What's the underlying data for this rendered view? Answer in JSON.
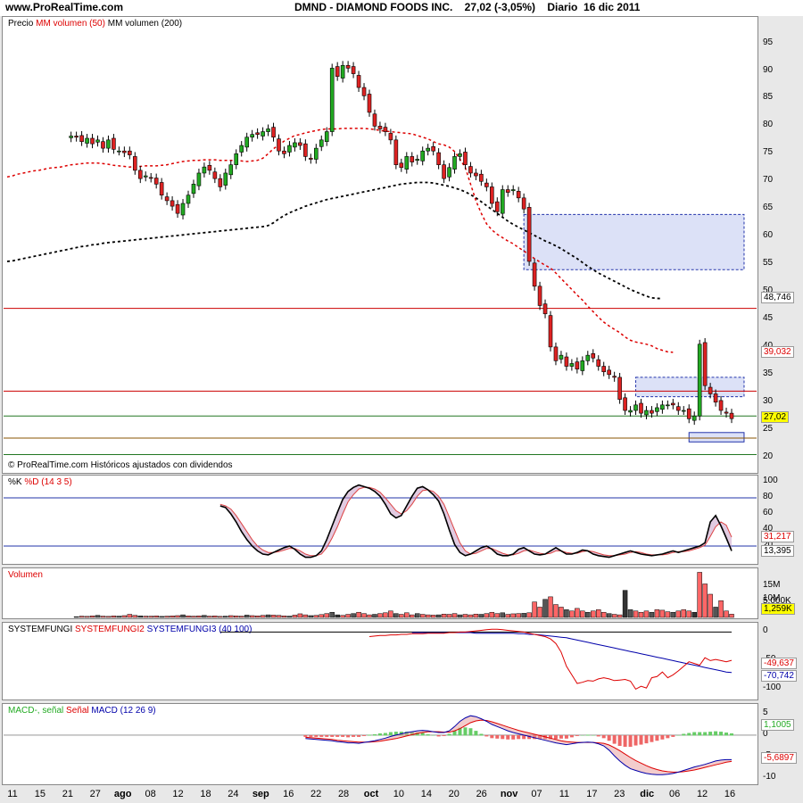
{
  "header": {
    "site": "www.ProRealTime.com",
    "title": "DMND - DIAMOND FOODS INC.    27,02 (-3,05%)    Diario  16 dic 2011"
  },
  "price_panel": {
    "legend_a": "Precio",
    "legend_b": "MM volumen (50)",
    "legend_c": "MM volumen (200)",
    "footer": "© ProRealTime.com  Históricos ajustados con dividendos",
    "ticks": [
      "95",
      "90",
      "85",
      "80",
      "75",
      "70",
      "65",
      "60",
      "55",
      "50",
      "45",
      "40",
      "35",
      "30",
      "25",
      "20"
    ],
    "value_boxes": {
      "ma200": "48,746",
      "ma50": "39,032",
      "last": "27,02"
    }
  },
  "stoch_panel": {
    "legend_a": "%K",
    "legend_b": "%D (14 3 5)",
    "ticks": [
      "100",
      "80",
      "60",
      "40",
      "20"
    ],
    "value_boxes": {
      "d": "31,217",
      "k": "13,395"
    }
  },
  "volume_panel": {
    "legend": "Volumen",
    "ticks": [
      "15M",
      "10M",
      "5,000K"
    ],
    "value_box": "1,259K"
  },
  "system_panel": {
    "legend_a": "SYSTEMFUNGI",
    "legend_b": "SYSTEMFUNGI2",
    "legend_c": "SYSTEMFUNGI3 (40 100)",
    "ticks": [
      "0",
      "-50",
      "-100"
    ],
    "value_boxes": {
      "red": "-49,637",
      "blue": "-70,742"
    }
  },
  "macd_panel": {
    "legend_a": "MACD-, señal",
    "legend_b": "Señal",
    "legend_c": "MACD (12 26 9)",
    "ticks": [
      "5",
      "0",
      "-5",
      "-10"
    ],
    "value_boxes": {
      "hist": "1,1005",
      "macd": "-5,6897"
    }
  },
  "x_axis": [
    {
      "label": "11",
      "bold": false
    },
    {
      "label": "15",
      "bold": false
    },
    {
      "label": "21",
      "bold": false
    },
    {
      "label": "27",
      "bold": false
    },
    {
      "label": "ago",
      "bold": true
    },
    {
      "label": "08",
      "bold": false
    },
    {
      "label": "12",
      "bold": false
    },
    {
      "label": "18",
      "bold": false
    },
    {
      "label": "24",
      "bold": false
    },
    {
      "label": "sep",
      "bold": true
    },
    {
      "label": "16",
      "bold": false
    },
    {
      "label": "22",
      "bold": false
    },
    {
      "label": "28",
      "bold": false
    },
    {
      "label": "oct",
      "bold": true
    },
    {
      "label": "10",
      "bold": false
    },
    {
      "label": "14",
      "bold": false
    },
    {
      "label": "20",
      "bold": false
    },
    {
      "label": "26",
      "bold": false
    },
    {
      "label": "nov",
      "bold": true
    },
    {
      "label": "07",
      "bold": false
    },
    {
      "label": "11",
      "bold": false
    },
    {
      "label": "17",
      "bold": false
    },
    {
      "label": "23",
      "bold": false
    },
    {
      "label": "dic",
      "bold": true
    },
    {
      "label": "06",
      "bold": false
    },
    {
      "label": "12",
      "bold": false
    },
    {
      "label": "16",
      "bold": false
    }
  ],
  "colors": {
    "up": "#22aa22",
    "down": "#dd2222",
    "ma50": "#dd0000",
    "ma200": "#000000",
    "grid": "#cc0000",
    "zone": "#bfc8f0"
  },
  "chart_data": {
    "type": "candlestick",
    "bars": 137,
    "price_ylim": [
      18,
      98
    ],
    "closes": [
      78.2,
      78.0,
      77.2,
      77.8,
      76.8,
      77.5,
      76.0,
      77.5,
      75.8,
      75.5,
      75.2,
      74.8,
      72.0,
      70.5,
      71.0,
      70.6,
      69.5,
      67.5,
      66.5,
      65.5,
      64.2,
      66.0,
      67.5,
      69.5,
      71.5,
      72.6,
      72.0,
      70.5,
      69.0,
      71.5,
      73.0,
      75.0,
      76.5,
      78.0,
      78.5,
      78.5,
      79.0,
      79.5,
      78.0,
      75.5,
      75.0,
      76.5,
      77.0,
      76.5,
      74.5,
      74.0,
      76.0,
      77.5,
      79.0,
      90.5,
      89.0,
      91.0,
      90.5,
      89.5,
      87.0,
      85.5,
      82.5,
      80.0,
      79.5,
      79.0,
      77.5,
      73.0,
      72.5,
      74.5,
      73.5,
      74.0,
      75.5,
      76.0,
      75.5,
      73.0,
      70.5,
      72.5,
      74.5,
      75.0,
      73.0,
      71.5,
      71.0,
      70.0,
      69.0,
      66.0,
      64.5,
      68.5,
      68.0,
      68.5,
      67.0,
      65.0,
      55.5,
      51.0,
      47.5,
      46.0,
      40.0,
      37.5,
      38.5,
      36.5,
      37.0,
      36.0,
      37.5,
      38.5,
      38.0,
      36.5,
      35.5,
      35.0,
      34.5,
      30.5,
      28.5,
      28.5,
      29.5,
      28.0,
      28.5,
      28.0,
      29.0,
      29.5,
      29.5,
      29.5,
      28.5,
      28.5,
      27.0,
      27.5,
      40.5,
      33.0,
      31.5,
      30.0,
      28.5,
      28.0,
      27.02
    ],
    "ma50": [
      70.8,
      71.0,
      71.3,
      71.5,
      71.7,
      71.9,
      72.0,
      72.2,
      72.4,
      72.5,
      72.6,
      72.8,
      73.0,
      73.1,
      73.2,
      73.3,
      73.3,
      73.3,
      73.2,
      73.1,
      72.9,
      72.8,
      72.7,
      72.6,
      72.7,
      72.7,
      72.8,
      72.8,
      72.8,
      72.9,
      73.0,
      73.2,
      73.4,
      73.6,
      73.7,
      73.8,
      73.8,
      73.9,
      73.9,
      73.9,
      73.8,
      73.8,
      73.8,
      73.8,
      73.7,
      73.6,
      73.7,
      73.8,
      74.2,
      75.0,
      75.9,
      76.6,
      77.3,
      77.8,
      78.3,
      78.5,
      78.8,
      79.0,
      79.2,
      79.4,
      79.5,
      79.5,
      79.5,
      79.6,
      79.6,
      79.6,
      79.6,
      79.6,
      79.5,
      79.4,
      79.2,
      79.1,
      79.0,
      78.9,
      78.8,
      78.7,
      78.6,
      78.3,
      78.0,
      77.7,
      77.2,
      76.8,
      76.6,
      76.2,
      75.4,
      74.0,
      72.5,
      69.5,
      66.5,
      64.2,
      62.3,
      61.2,
      60.4,
      59.8,
      59.2,
      58.7,
      58.0,
      57.4,
      56.7,
      56.0,
      55.4,
      54.8,
      54.3,
      53.4,
      52.4,
      51.4,
      50.4,
      49.4,
      48.5,
      47.4,
      46.4,
      45.4,
      44.5,
      43.8,
      43.2,
      42.6,
      41.8,
      41.2,
      40.9,
      40.7,
      40.5,
      40.2,
      39.7,
      39.4,
      39.1,
      39.03
    ],
    "ma200": [
      55.5,
      55.6,
      55.8,
      56.0,
      56.2,
      56.4,
      56.6,
      56.8,
      57.0,
      57.2,
      57.4,
      57.6,
      57.8,
      58.0,
      58.2,
      58.3,
      58.5,
      58.6,
      58.8,
      58.9,
      59.0,
      59.1,
      59.2,
      59.3,
      59.4,
      59.5,
      59.6,
      59.7,
      59.8,
      59.9,
      60.0,
      60.1,
      60.2,
      60.3,
      60.4,
      60.5,
      60.6,
      60.7,
      60.8,
      60.9,
      61.0,
      61.1,
      61.2,
      61.3,
      61.4,
      61.5,
      61.6,
      61.7,
      61.8,
      62.0,
      62.5,
      63.2,
      63.8,
      64.3,
      64.7,
      65.1,
      65.5,
      65.8,
      66.1,
      66.4,
      66.7,
      66.9,
      67.1,
      67.3,
      67.5,
      67.7,
      67.9,
      68.1,
      68.3,
      68.5,
      68.7,
      68.9,
      69.1,
      69.3,
      69.5,
      69.6,
      69.7,
      69.8,
      69.8,
      69.8,
      69.7,
      69.5,
      69.3,
      69.1,
      68.8,
      68.5,
      68.1,
      67.6,
      67.0,
      66.3,
      65.6,
      64.9,
      64.2,
      63.5,
      62.8,
      62.2,
      61.7,
      61.2,
      60.7,
      60.2,
      59.7,
      59.2,
      58.8,
      58.3,
      57.8,
      57.2,
      56.6,
      56.0,
      55.3,
      54.6,
      54.0,
      53.4,
      52.9,
      52.4,
      51.9,
      51.4,
      50.9,
      50.4,
      50.0,
      49.6,
      49.2,
      48.9,
      48.8,
      48.75
    ],
    "h_lines": [
      47.0,
      32.0,
      27.5,
      23.5,
      20.5
    ],
    "zones": [
      {
        "from_bar": 97,
        "to_bar": 137,
        "low": 54.0,
        "high": 64.0
      },
      {
        "from_bar": 118,
        "to_bar": 137,
        "low": 31.0,
        "high": 34.5
      },
      {
        "from_bar": 128,
        "to_bar": 137,
        "low": 22.8,
        "high": 24.5
      }
    ],
    "stoch_ylim": [
      0,
      100
    ],
    "stoch_k": [
      70,
      68,
      60,
      50,
      38,
      28,
      20,
      14,
      10,
      9,
      12,
      15,
      18,
      20,
      16,
      10,
      6,
      6,
      8,
      14,
      28,
      45,
      62,
      78,
      88,
      93,
      96,
      94,
      92,
      88,
      82,
      72,
      60,
      55,
      58,
      70,
      82,
      92,
      94,
      90,
      84,
      76,
      60,
      40,
      22,
      12,
      8,
      10,
      14,
      18,
      20,
      16,
      10,
      8,
      8,
      10,
      16,
      18,
      14,
      10,
      9,
      10,
      14,
      18,
      14,
      10,
      10,
      12,
      15,
      14,
      10,
      8,
      7,
      6,
      8,
      10,
      12,
      14,
      12,
      10,
      9,
      8,
      9,
      10,
      12,
      14,
      12,
      14,
      16,
      18,
      20,
      24,
      50,
      58,
      45,
      30,
      14
    ],
    "stoch_d": [
      72,
      70,
      66,
      58,
      48,
      38,
      28,
      20,
      15,
      12,
      12,
      13,
      15,
      17,
      17,
      14,
      10,
      8,
      8,
      10,
      18,
      30,
      44,
      60,
      75,
      84,
      91,
      93,
      93,
      91,
      87,
      80,
      72,
      64,
      60,
      64,
      72,
      82,
      89,
      90,
      88,
      82,
      72,
      56,
      40,
      24,
      14,
      10,
      11,
      14,
      17,
      17,
      14,
      11,
      9,
      9,
      11,
      14,
      15,
      13,
      11,
      10,
      11,
      14,
      14,
      12,
      11,
      11,
      13,
      14,
      13,
      11,
      9,
      8,
      8,
      9,
      10,
      12,
      13,
      12,
      10,
      9,
      9,
      9,
      10,
      12,
      13,
      13,
      14,
      16,
      18,
      21,
      32,
      44,
      50,
      46,
      31
    ],
    "volume_ylim": [
      0,
      18
    ],
    "volume": [
      0.3,
      0.5,
      0.4,
      0.6,
      0.8,
      0.5,
      0.4,
      0.6,
      0.5,
      0.7,
      1.2,
      0.8,
      0.6,
      0.5,
      0.5,
      0.6,
      0.4,
      0.5,
      0.6,
      0.7,
      1.0,
      0.6,
      0.5,
      0.6,
      0.8,
      0.5,
      0.6,
      0.4,
      0.5,
      0.7,
      0.6,
      0.5,
      0.9,
      0.7,
      0.6,
      0.8,
      1.0,
      0.9,
      0.8,
      0.6,
      0.5,
      0.9,
      1.4,
      1.0,
      0.7,
      0.8,
      1.1,
      1.5,
      2.0,
      1.0,
      0.8,
      1.2,
      1.5,
      2.0,
      1.5,
      1.0,
      1.2,
      1.5,
      1.8,
      2.5,
      1.5,
      1.2,
      1.8,
      1.0,
      1.5,
      1.2,
      1.0,
      0.9,
      1.0,
      1.3,
      1.2,
      1.5,
      1.0,
      1.2,
      1.0,
      1.3,
      1.2,
      1.5,
      2.0,
      1.5,
      1.8,
      1.2,
      1.4,
      1.5,
      1.6,
      1.8,
      6.0,
      4.0,
      7.0,
      8.0,
      5.0,
      4.0,
      3.0,
      2.5,
      3.5,
      2.5,
      2.0,
      2.5,
      3.0,
      2.0,
      1.5,
      1.2,
      1.0,
      10.5,
      3.0,
      2.5,
      2.0,
      2.5,
      2.0,
      3.0,
      2.8,
      2.2,
      2.0,
      2.5,
      3.0,
      2.5,
      2.0,
      17.5,
      13.0,
      9.0,
      4.0,
      6.5,
      2.5,
      1.26
    ],
    "system_ylim": [
      -115,
      10
    ],
    "system_fungi": [
      0,
      0,
      0,
      0,
      0,
      0,
      0,
      0,
      0,
      0,
      0,
      0,
      0,
      0,
      0,
      0,
      0,
      0,
      0,
      0,
      0,
      0,
      0,
      0,
      0,
      0,
      0,
      0,
      0,
      0,
      0,
      0,
      0,
      0,
      0,
      0,
      0,
      0,
      0,
      0,
      0,
      0,
      0,
      0,
      0,
      0,
      0,
      0,
      0,
      0,
      0,
      0,
      0,
      0,
      0,
      0,
      0,
      0,
      0,
      0,
      0,
      0,
      0,
      0,
      0,
      0,
      0,
      0,
      0,
      0,
      0,
      0,
      0,
      0,
      0,
      0,
      0,
      0,
      0,
      0,
      0,
      0,
      0,
      0,
      0,
      0,
      0,
      0,
      0,
      0,
      0,
      0,
      0,
      0,
      0,
      0,
      0
    ],
    "system_fungi2": [
      -8,
      -7,
      -6,
      -6,
      -5,
      -5,
      -4,
      -4,
      -3,
      -3,
      -3,
      -2,
      -2,
      -2,
      -2,
      -1,
      -1,
      0,
      0,
      1,
      2,
      3,
      4,
      5,
      5,
      4,
      3,
      2,
      1,
      0,
      -2,
      -4,
      -6,
      -8,
      -12,
      -20,
      -35,
      -60,
      -75,
      -90,
      -88,
      -85,
      -86,
      -82,
      -80,
      -82,
      -85,
      -84,
      -83,
      -86,
      -100,
      -95,
      -98,
      -80,
      -78,
      -70,
      -80,
      -75,
      -68,
      -60,
      -52,
      -55,
      -58,
      -45,
      -50,
      -48,
      -50,
      -52,
      -49.6
    ],
    "system_fungi3": [
      -1,
      -1,
      -1,
      -1,
      -1,
      -1,
      -1,
      -1,
      -1,
      -1,
      -1,
      -1,
      -2,
      -2,
      -2,
      -2,
      -2,
      -2,
      -2,
      -2,
      -3,
      -3,
      -4,
      -4,
      -5,
      -6,
      -7,
      -8,
      -9,
      -10,
      -12,
      -14,
      -16,
      -18,
      -20,
      -22,
      -24,
      -26,
      -28,
      -30,
      -32,
      -34,
      -36,
      -38,
      -40,
      -42,
      -44,
      -46,
      -48,
      -50,
      -52,
      -54,
      -56,
      -58,
      -60,
      -62,
      -64,
      -66,
      -68,
      -70,
      -70.74
    ],
    "macd_ylim": [
      -11,
      6
    ],
    "macd": [
      -0.8,
      -0.9,
      -1.0,
      -1.1,
      -1.2,
      -1.3,
      -1.5,
      -1.6,
      -1.8,
      -1.8,
      -1.9,
      -1.7,
      -1.5,
      -1.3,
      -1.0,
      -0.7,
      -0.3,
      0.0,
      0.3,
      0.6,
      0.8,
      1.0,
      1.1,
      1.0,
      0.8,
      0.6,
      0.6,
      1.0,
      2.0,
      3.2,
      4.0,
      4.5,
      4.3,
      3.8,
      3.2,
      2.5,
      2.0,
      1.5,
      1.0,
      0.6,
      0.3,
      0.0,
      -0.3,
      -0.6,
      -0.9,
      -1.2,
      -1.5,
      -1.8,
      -2.0,
      -2.2,
      -2.0,
      -1.8,
      -1.7,
      -1.6,
      -1.7,
      -2.0,
      -2.5,
      -3.5,
      -4.8,
      -6.0,
      -7.0,
      -7.8,
      -8.2,
      -8.6,
      -8.9,
      -9.1,
      -9.2,
      -9.2,
      -9.1,
      -8.9,
      -8.6,
      -8.2,
      -7.8,
      -7.4,
      -7.1,
      -6.8,
      -6.4,
      -6.0,
      -5.8,
      -5.7,
      -5.69
    ],
    "macd_signal": [
      -0.5,
      -0.6,
      -0.7,
      -0.8,
      -0.9,
      -1.0,
      -1.2,
      -1.3,
      -1.4,
      -1.5,
      -1.6,
      -1.6,
      -1.6,
      -1.5,
      -1.4,
      -1.2,
      -1.0,
      -0.8,
      -0.5,
      -0.2,
      0.1,
      0.4,
      0.6,
      0.8,
      0.8,
      0.8,
      0.7,
      0.7,
      1.0,
      1.5,
      2.2,
      2.9,
      3.3,
      3.5,
      3.4,
      3.1,
      2.7,
      2.3,
      1.9,
      1.5,
      1.1,
      0.8,
      0.5,
      0.2,
      -0.1,
      -0.4,
      -0.7,
      -1.0,
      -1.3,
      -1.5,
      -1.6,
      -1.7,
      -1.7,
      -1.7,
      -1.7,
      -1.8,
      -1.9,
      -2.3,
      -2.9,
      -3.6,
      -4.4,
      -5.2,
      -5.9,
      -6.5,
      -7.1,
      -7.6,
      -8.0,
      -8.3,
      -8.5,
      -8.6,
      -8.6,
      -8.5,
      -8.3,
      -8.1,
      -7.8,
      -7.5,
      -7.2,
      -6.9,
      -6.6,
      -6.3,
      -6.1
    ]
  }
}
